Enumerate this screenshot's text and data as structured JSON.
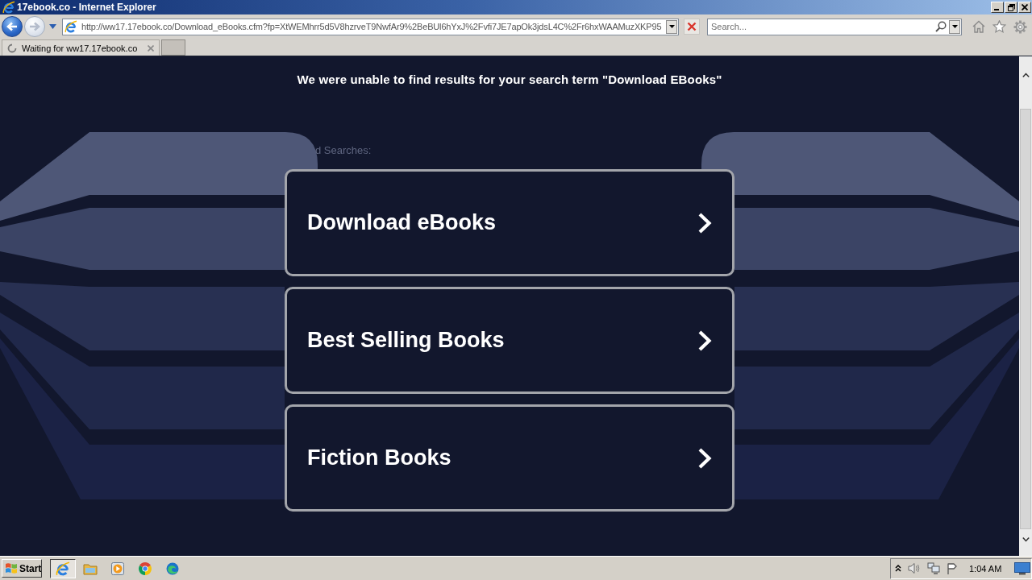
{
  "window": {
    "title": "17ebook.co - Internet Explorer"
  },
  "navigation": {
    "back": {
      "disabled": false
    },
    "forward": {
      "disabled": true
    },
    "address": "http://ww17.17ebook.co/Download_eBooks.cfm?fp=XtWEMhrr5d5V8hzrveT9NwfAr9%2BeBUl6hYxJ%2Fvfi7JE7apOk3jdsL4C%2Fr6hxWAAMuzXKP95",
    "search": {
      "placeholder": "Search..."
    }
  },
  "tabs": [
    {
      "label": "Waiting for ww17.17ebook.co",
      "selected": true,
      "loading": true
    }
  ],
  "page": {
    "heading": "We were unable to find results for your search term \"Download EBooks\"",
    "related_label": "d Searches:",
    "links": [
      {
        "label": "Download eBooks"
      },
      {
        "label": "Best Selling Books"
      },
      {
        "label": "Fiction Books"
      }
    ]
  },
  "taskbar": {
    "start_label": "Start",
    "apps": [
      {
        "selected": true
      },
      {
        "selected": false
      },
      {
        "selected": false
      },
      {
        "selected": false
      },
      {
        "selected": false
      }
    ],
    "clock": "1:04 AM"
  }
}
